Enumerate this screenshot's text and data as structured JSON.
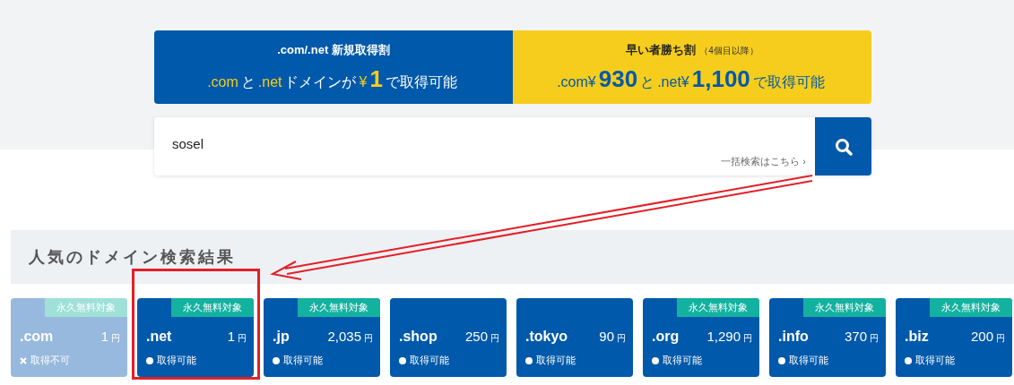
{
  "banners": [
    {
      "kind": "blue",
      "title": ".com/.net 新規取得割",
      "segments": [
        {
          "text": ".com",
          "kind": "accent"
        },
        {
          "text": "と",
          "kind": "plain"
        },
        {
          "text": ".net",
          "kind": "accent"
        },
        {
          "text": "ドメインが",
          "kind": "plain"
        },
        {
          "text": "¥",
          "kind": "accent"
        },
        {
          "text": "1",
          "kind": "big"
        },
        {
          "text": "で取得可能",
          "kind": "plain"
        }
      ]
    },
    {
      "kind": "yellow",
      "title": "早い者勝ち割",
      "note": "（4個目以降）",
      "segments": [
        {
          "text": ".com¥",
          "kind": "accent"
        },
        {
          "text": "930",
          "kind": "big"
        },
        {
          "text": "と",
          "kind": "plain"
        },
        {
          "text": ".net¥",
          "kind": "accent"
        },
        {
          "text": "1,100",
          "kind": "big"
        },
        {
          "text": "で取得可能",
          "kind": "accent"
        }
      ]
    }
  ],
  "search": {
    "value": "sosel",
    "bulk_link": "一括検索はこちら ›"
  },
  "results": {
    "title": "人気のドメイン検索結果",
    "cards": [
      {
        "name": ".com",
        "price": "1",
        "unit": "円",
        "badge": "永久無料対象",
        "available": false,
        "status": "取得不可",
        "highlighted": false
      },
      {
        "name": ".net",
        "price": "1",
        "unit": "円",
        "badge": "永久無料対象",
        "available": true,
        "status": "取得可能",
        "highlighted": true
      },
      {
        "name": ".jp",
        "price": "2,035",
        "unit": "円",
        "badge": "永久無料対象",
        "available": true,
        "status": "取得可能",
        "highlighted": false
      },
      {
        "name": ".shop",
        "price": "250",
        "unit": "円",
        "available": true,
        "status": "取得可能",
        "highlighted": false
      },
      {
        "name": ".tokyo",
        "price": "90",
        "unit": "円",
        "available": true,
        "status": "取得可能",
        "highlighted": false
      },
      {
        "name": ".org",
        "price": "1,290",
        "unit": "円",
        "badge": "永久無料対象",
        "available": true,
        "status": "取得可能",
        "highlighted": false
      },
      {
        "name": ".info",
        "price": "370",
        "unit": "円",
        "badge": "永久無料対象",
        "available": true,
        "status": "取得可能",
        "highlighted": false
      },
      {
        "name": ".biz",
        "price": "200",
        "unit": "円",
        "badge": "永久無料対象",
        "available": true,
        "status": "取得可能",
        "highlighted": false
      }
    ]
  }
}
